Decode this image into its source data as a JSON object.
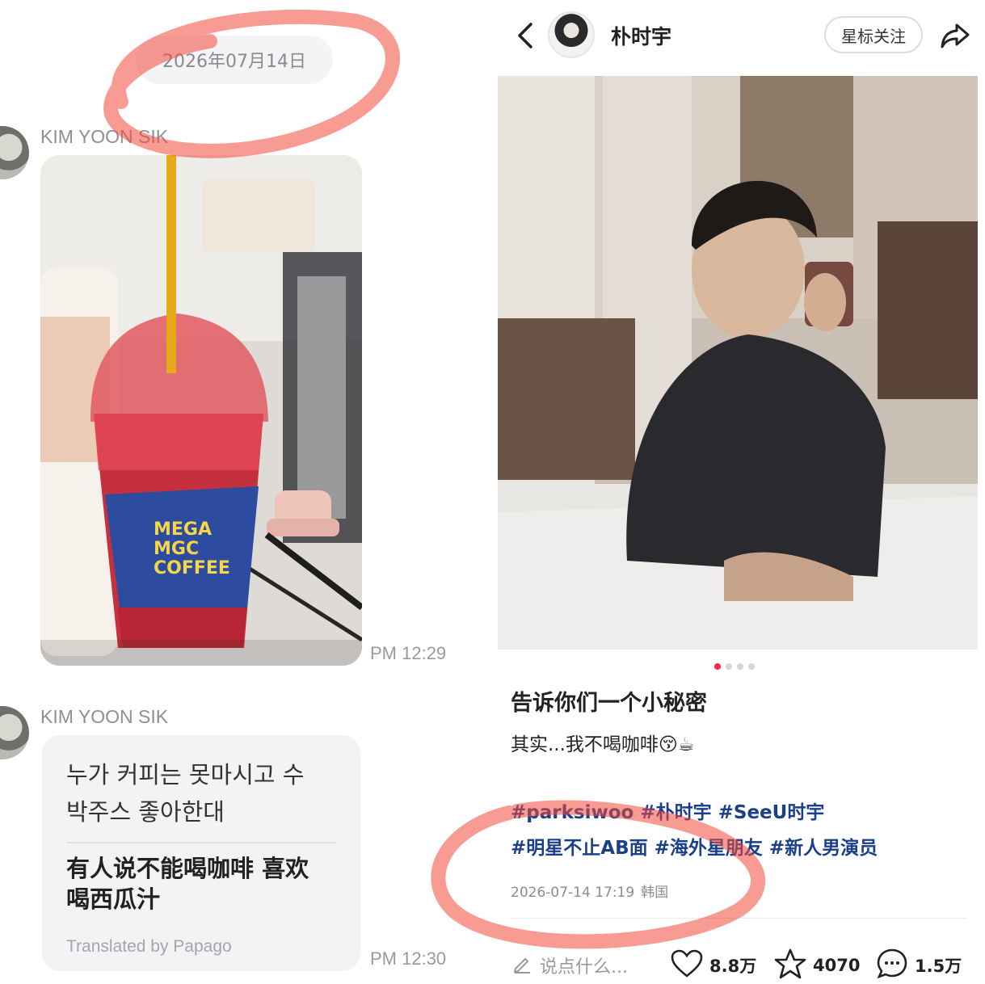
{
  "chat": {
    "date": "2026年07月14日",
    "messages": [
      {
        "sender": "KIM YOON SIK",
        "time": "PM 12:29"
      },
      {
        "sender": "KIM YOON SIK",
        "original": [
          "누가 커피는 못마시고 수",
          "박주스 좋아한대"
        ],
        "translation": [
          "有人说不能喝咖啡 喜欢",
          "喝西瓜汁"
        ],
        "translated_by": "Translated by Papago",
        "time": "PM 12:30"
      }
    ],
    "cup_label": [
      "MEGA",
      "MGC",
      "COFFEE"
    ]
  },
  "post": {
    "author": "朴时宇",
    "follow_label": "星标关注",
    "title": "告诉你们一个小秘密",
    "body": "其实...我不喝咖啡😚☕",
    "tags": [
      "#parksiwoo",
      "#朴时宇",
      "#SeeU时宇",
      "#明星不止AB面",
      "#海外星朋友",
      "#新人男演员"
    ],
    "date": "2026-07-14 17:19",
    "location": "韩国",
    "comment_placeholder": "说点什么...",
    "likes": "8.8万",
    "favorites": "4070",
    "comments": "1.5万"
  },
  "colors": {
    "accent": "#ff2442",
    "tag": "#1b3f8b",
    "annotation": "#f0483a"
  },
  "icons": [
    "back-icon",
    "share-icon",
    "pencil-icon",
    "heart-icon",
    "star-icon",
    "comment-icon"
  ]
}
